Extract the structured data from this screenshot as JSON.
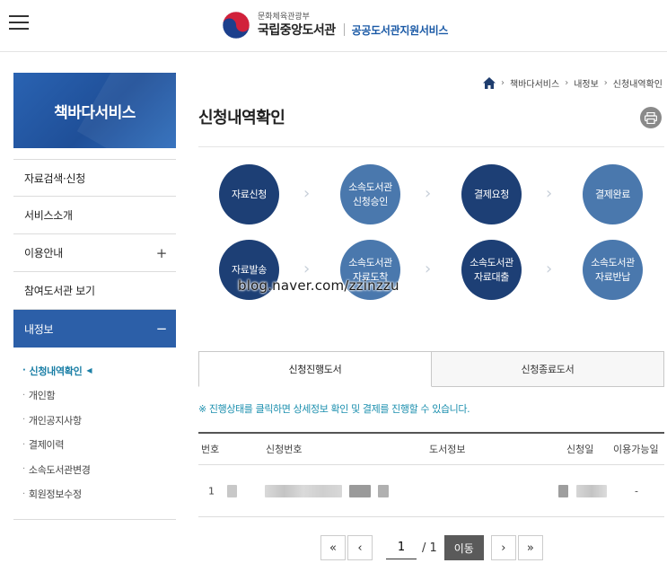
{
  "header": {
    "ministry": "문화체육관광부",
    "library": "국립중앙도서관",
    "service": "공공도서관지원서비스"
  },
  "sidebar": {
    "banner_title": "책바다서비스",
    "items": [
      {
        "label": "자료검색·신청"
      },
      {
        "label": "서비스소개"
      },
      {
        "label": "이용안내",
        "toggle": "+"
      },
      {
        "label": "참여도서관 보기"
      },
      {
        "label": "내정보",
        "toggle": "−"
      }
    ],
    "sub_items": [
      {
        "label": "신청내역확인",
        "current": true
      },
      {
        "label": "개인함"
      },
      {
        "label": "개인공지사항"
      },
      {
        "label": "결제이력"
      },
      {
        "label": "소속도서관변경"
      },
      {
        "label": "회원정보수정"
      }
    ]
  },
  "breadcrumb": {
    "items": [
      "책바다서비스",
      "내정보",
      "신청내역확인"
    ]
  },
  "page_title": "신청내역확인",
  "steps": [
    {
      "label": "자료신청",
      "style": "dark"
    },
    {
      "label": "소속도서관\n신청승인",
      "style": "light"
    },
    {
      "label": "결제요청",
      "style": "dark"
    },
    {
      "label": "결제완료",
      "style": "light"
    },
    {
      "label": "자료발송",
      "style": "dark"
    },
    {
      "label": "소속도서관\n자료도착",
      "style": "light"
    },
    {
      "label": "소속도서관\n자료대출",
      "style": "dark"
    },
    {
      "label": "소속도서관\n자료반납",
      "style": "light"
    }
  ],
  "watermark": "blog.naver.com/zzinzzu",
  "tabs": [
    {
      "label": "신청진행도서",
      "active": true
    },
    {
      "label": "신청종료도서",
      "active": false
    }
  ],
  "notice": "※ 진행상태를 클릭하면 상세정보 확인 및 결제를 진행할 수 있습니다.",
  "table": {
    "headers": [
      "번호",
      "신청번호",
      "도서정보",
      "신청일",
      "이용가능일"
    ],
    "rows": [
      {
        "no": "1",
        "available": "-"
      }
    ]
  },
  "pagination": {
    "first": "«",
    "prev": "‹",
    "current": "1",
    "total": "/ 1",
    "go": "이동",
    "next": "›",
    "last": "»"
  },
  "colors": {
    "brand_blue": "#2c5fa8",
    "step_dark": "#1d3f75",
    "step_light": "#4a78ad",
    "notice": "#1b8fae"
  }
}
